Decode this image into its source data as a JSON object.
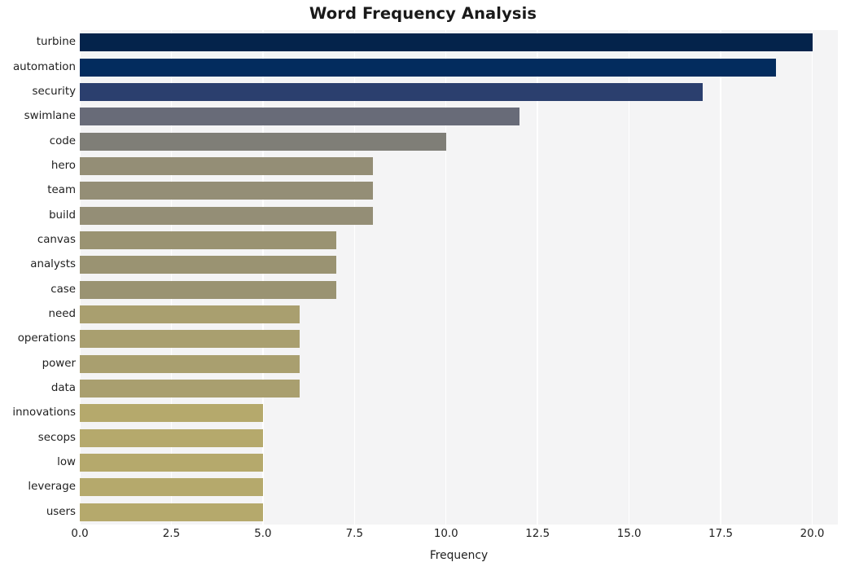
{
  "chart_data": {
    "type": "bar",
    "orientation": "horizontal",
    "title": "Word Frequency Analysis",
    "xlabel": "Frequency",
    "ylabel": "",
    "categories": [
      "turbine",
      "automation",
      "security",
      "swimlane",
      "code",
      "hero",
      "team",
      "build",
      "canvas",
      "analysts",
      "case",
      "need",
      "operations",
      "power",
      "data",
      "innovations",
      "secops",
      "low",
      "leverage",
      "users"
    ],
    "values": [
      20,
      19,
      17,
      12,
      10,
      8,
      8,
      8,
      7,
      7,
      7,
      6,
      6,
      6,
      6,
      5,
      5,
      5,
      5,
      5
    ],
    "bar_colors": [
      "#04234b",
      "#032c5e",
      "#2b3f6e",
      "#686b78",
      "#7f7e77",
      "#948e76",
      "#948e76",
      "#948e76",
      "#9a9372",
      "#9a9372",
      "#9a9372",
      "#a99f6f",
      "#a99f6f",
      "#a99f6f",
      "#a99f6f",
      "#b5a96c",
      "#b5a96c",
      "#b5a96c",
      "#b5a96c",
      "#b5a96c"
    ],
    "xlim": [
      0,
      20.7
    ],
    "xticks": [
      0,
      2.5,
      5,
      7.5,
      10,
      12.5,
      15,
      17.5,
      20
    ],
    "xtick_labels": [
      "0.0",
      "2.5",
      "5.0",
      "7.5",
      "10.0",
      "12.5",
      "15.0",
      "17.5",
      "20.0"
    ],
    "grid": true,
    "grid_axis": "x",
    "grid_color": "#ffffff",
    "plot_background": "#f4f4f5",
    "figure_background": "#ffffff",
    "legend": null
  }
}
